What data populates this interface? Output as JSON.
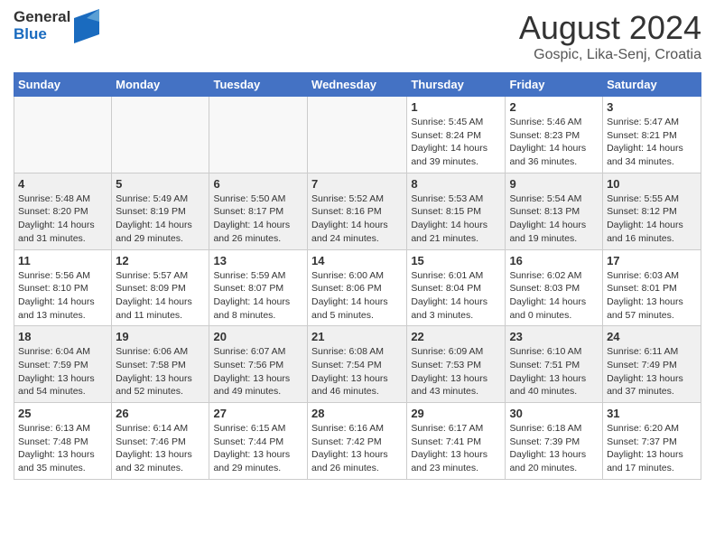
{
  "header": {
    "logo": {
      "general": "General",
      "blue": "Blue"
    },
    "title": "August 2024",
    "location": "Gospic, Lika-Senj, Croatia"
  },
  "calendar": {
    "days_of_week": [
      "Sunday",
      "Monday",
      "Tuesday",
      "Wednesday",
      "Thursday",
      "Friday",
      "Saturday"
    ],
    "weeks": [
      {
        "days": [
          {
            "num": "",
            "info": ""
          },
          {
            "num": "",
            "info": ""
          },
          {
            "num": "",
            "info": ""
          },
          {
            "num": "",
            "info": ""
          },
          {
            "num": "1",
            "info": "Sunrise: 5:45 AM\nSunset: 8:24 PM\nDaylight: 14 hours\nand 39 minutes."
          },
          {
            "num": "2",
            "info": "Sunrise: 5:46 AM\nSunset: 8:23 PM\nDaylight: 14 hours\nand 36 minutes."
          },
          {
            "num": "3",
            "info": "Sunrise: 5:47 AM\nSunset: 8:21 PM\nDaylight: 14 hours\nand 34 minutes."
          }
        ]
      },
      {
        "days": [
          {
            "num": "4",
            "info": "Sunrise: 5:48 AM\nSunset: 8:20 PM\nDaylight: 14 hours\nand 31 minutes."
          },
          {
            "num": "5",
            "info": "Sunrise: 5:49 AM\nSunset: 8:19 PM\nDaylight: 14 hours\nand 29 minutes."
          },
          {
            "num": "6",
            "info": "Sunrise: 5:50 AM\nSunset: 8:17 PM\nDaylight: 14 hours\nand 26 minutes."
          },
          {
            "num": "7",
            "info": "Sunrise: 5:52 AM\nSunset: 8:16 PM\nDaylight: 14 hours\nand 24 minutes."
          },
          {
            "num": "8",
            "info": "Sunrise: 5:53 AM\nSunset: 8:15 PM\nDaylight: 14 hours\nand 21 minutes."
          },
          {
            "num": "9",
            "info": "Sunrise: 5:54 AM\nSunset: 8:13 PM\nDaylight: 14 hours\nand 19 minutes."
          },
          {
            "num": "10",
            "info": "Sunrise: 5:55 AM\nSunset: 8:12 PM\nDaylight: 14 hours\nand 16 minutes."
          }
        ]
      },
      {
        "days": [
          {
            "num": "11",
            "info": "Sunrise: 5:56 AM\nSunset: 8:10 PM\nDaylight: 14 hours\nand 13 minutes."
          },
          {
            "num": "12",
            "info": "Sunrise: 5:57 AM\nSunset: 8:09 PM\nDaylight: 14 hours\nand 11 minutes."
          },
          {
            "num": "13",
            "info": "Sunrise: 5:59 AM\nSunset: 8:07 PM\nDaylight: 14 hours\nand 8 minutes."
          },
          {
            "num": "14",
            "info": "Sunrise: 6:00 AM\nSunset: 8:06 PM\nDaylight: 14 hours\nand 5 minutes."
          },
          {
            "num": "15",
            "info": "Sunrise: 6:01 AM\nSunset: 8:04 PM\nDaylight: 14 hours\nand 3 minutes."
          },
          {
            "num": "16",
            "info": "Sunrise: 6:02 AM\nSunset: 8:03 PM\nDaylight: 14 hours\nand 0 minutes."
          },
          {
            "num": "17",
            "info": "Sunrise: 6:03 AM\nSunset: 8:01 PM\nDaylight: 13 hours\nand 57 minutes."
          }
        ]
      },
      {
        "days": [
          {
            "num": "18",
            "info": "Sunrise: 6:04 AM\nSunset: 7:59 PM\nDaylight: 13 hours\nand 54 minutes."
          },
          {
            "num": "19",
            "info": "Sunrise: 6:06 AM\nSunset: 7:58 PM\nDaylight: 13 hours\nand 52 minutes."
          },
          {
            "num": "20",
            "info": "Sunrise: 6:07 AM\nSunset: 7:56 PM\nDaylight: 13 hours\nand 49 minutes."
          },
          {
            "num": "21",
            "info": "Sunrise: 6:08 AM\nSunset: 7:54 PM\nDaylight: 13 hours\nand 46 minutes."
          },
          {
            "num": "22",
            "info": "Sunrise: 6:09 AM\nSunset: 7:53 PM\nDaylight: 13 hours\nand 43 minutes."
          },
          {
            "num": "23",
            "info": "Sunrise: 6:10 AM\nSunset: 7:51 PM\nDaylight: 13 hours\nand 40 minutes."
          },
          {
            "num": "24",
            "info": "Sunrise: 6:11 AM\nSunset: 7:49 PM\nDaylight: 13 hours\nand 37 minutes."
          }
        ]
      },
      {
        "days": [
          {
            "num": "25",
            "info": "Sunrise: 6:13 AM\nSunset: 7:48 PM\nDaylight: 13 hours\nand 35 minutes."
          },
          {
            "num": "26",
            "info": "Sunrise: 6:14 AM\nSunset: 7:46 PM\nDaylight: 13 hours\nand 32 minutes."
          },
          {
            "num": "27",
            "info": "Sunrise: 6:15 AM\nSunset: 7:44 PM\nDaylight: 13 hours\nand 29 minutes."
          },
          {
            "num": "28",
            "info": "Sunrise: 6:16 AM\nSunset: 7:42 PM\nDaylight: 13 hours\nand 26 minutes."
          },
          {
            "num": "29",
            "info": "Sunrise: 6:17 AM\nSunset: 7:41 PM\nDaylight: 13 hours\nand 23 minutes."
          },
          {
            "num": "30",
            "info": "Sunrise: 6:18 AM\nSunset: 7:39 PM\nDaylight: 13 hours\nand 20 minutes."
          },
          {
            "num": "31",
            "info": "Sunrise: 6:20 AM\nSunset: 7:37 PM\nDaylight: 13 hours\nand 17 minutes."
          }
        ]
      }
    ]
  }
}
